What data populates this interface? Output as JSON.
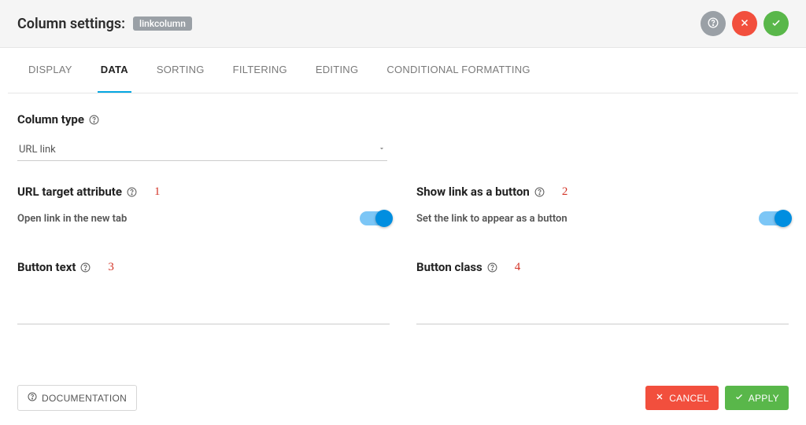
{
  "header": {
    "title": "Column settings:",
    "chip": "linkcolumn"
  },
  "tabs": [
    "DISPLAY",
    "DATA",
    "SORTING",
    "FILTERING",
    "EDITING",
    "CONDITIONAL FORMATTING"
  ],
  "activeTab": "DATA",
  "column_type": {
    "label": "Column type",
    "value": "URL link"
  },
  "url_target": {
    "label": "URL target attribute",
    "hint": "Open link in the new tab",
    "marker": "1",
    "on": true
  },
  "show_button": {
    "label": "Show link as a button",
    "hint": "Set the link to appear as a button",
    "marker": "2",
    "on": true
  },
  "btn_text": {
    "label": "Button text",
    "marker": "3",
    "value": ""
  },
  "btn_class": {
    "label": "Button class",
    "marker": "4",
    "value": ""
  },
  "footer": {
    "doc": "DOCUMENTATION",
    "cancel": "CANCEL",
    "apply": "APPLY"
  }
}
